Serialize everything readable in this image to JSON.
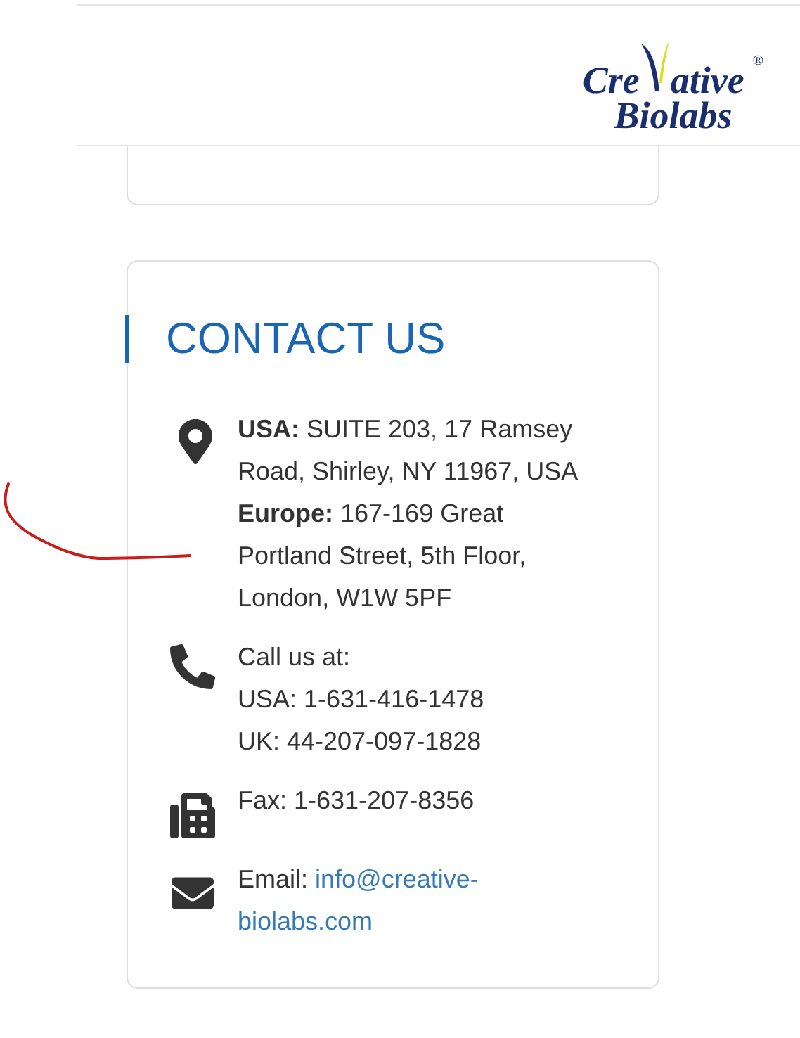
{
  "logo": {
    "line1_start": "Cre",
    "line1_end": "ative",
    "line2": "Biolabs",
    "mark": "®"
  },
  "contact": {
    "title": "CONTACT US",
    "items": [
      {
        "kind": "address",
        "lines": [
          "**USA:** SUITE 203, 17 Ramsey Road, Shirley, NY 11967, USA",
          "**Europe:** 167-169 Great Portland Street, 5th Floor, London, W1W 5PF"
        ]
      },
      {
        "kind": "phone",
        "lines": [
          "Call us at:",
          "USA: 1-631-416-1478",
          "UK: 44-207-097-1828"
        ]
      },
      {
        "kind": "fax",
        "lines": [
          "Fax: 1-631-207-8356"
        ]
      },
      {
        "kind": "email",
        "label": "Email:",
        "link": "info@creative-biolabs.com"
      }
    ]
  }
}
